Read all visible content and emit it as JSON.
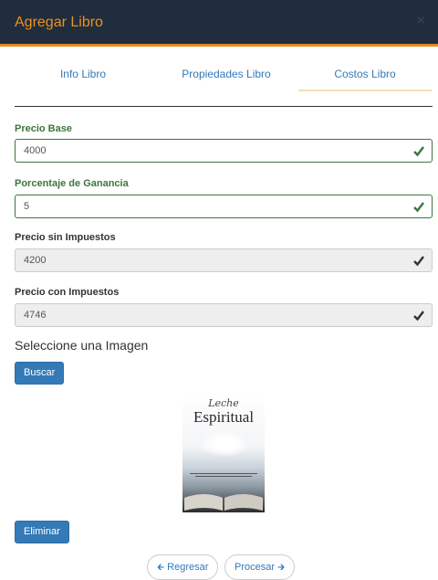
{
  "modal": {
    "title": "Agregar Libro",
    "close": "×"
  },
  "tabs": [
    {
      "label": "Info Libro"
    },
    {
      "label": "Propiedades Libro"
    },
    {
      "label": "Costos Libro"
    }
  ],
  "fields": {
    "precio_base": {
      "label": "Precio Base",
      "value": "4000"
    },
    "porcentaje": {
      "label": "Porcentaje de Ganancia",
      "value": "5"
    },
    "sin_impuestos": {
      "label": "Precio sin Impuestos",
      "value": "4200"
    },
    "con_impuestos": {
      "label": "Precio con Impuestos",
      "value": "4746"
    }
  },
  "image_section": {
    "title": "Seleccione una Imagen",
    "buscar_label": "Buscar",
    "eliminar_label": "Eliminar",
    "cover": {
      "line1": "Leche",
      "line2": "Espiritual"
    }
  },
  "pager": {
    "prev_label": "Regresar",
    "next_label": "Procesar",
    "prev_icon": "arrow-left-icon",
    "next_icon": "arrow-right-icon"
  },
  "colors": {
    "header_bg": "#1f2d3d",
    "title": "#f0901e",
    "success": "#3c763d",
    "primary": "#337ab7"
  }
}
